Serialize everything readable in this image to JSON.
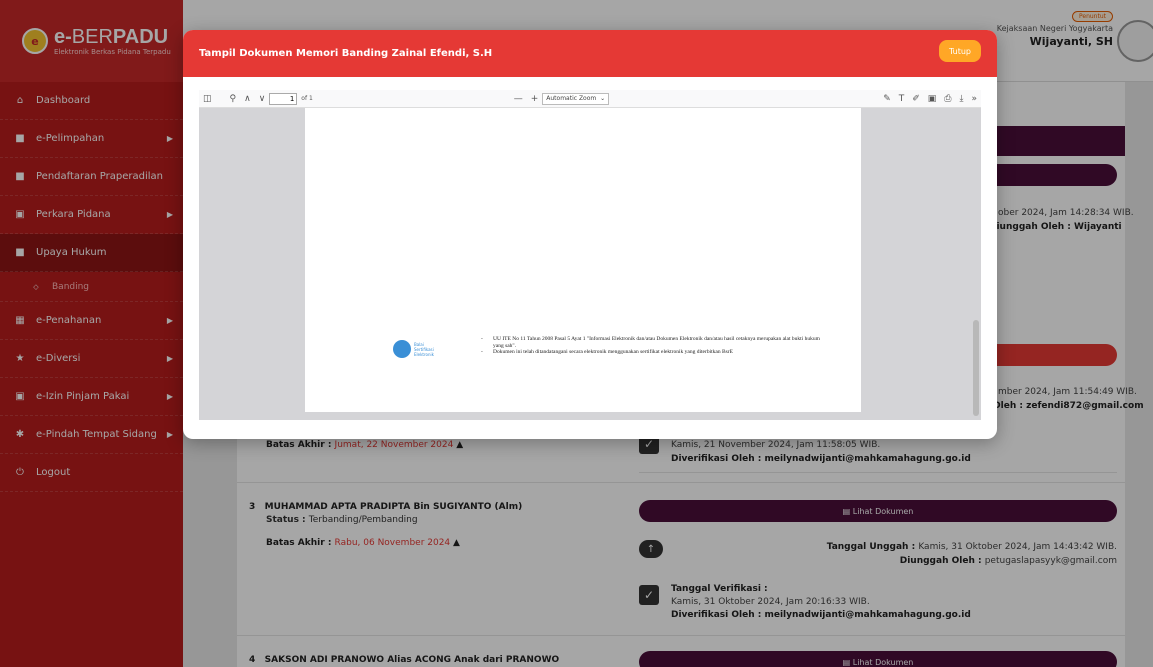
{
  "header": {
    "logo_badge": "e",
    "logo_title_prefix": "e-",
    "logo_title_thin": "BER",
    "logo_title_bold": "PADU",
    "logo_sub": "Elektronik Berkas Pidana Terpadu",
    "role": "Penuntut",
    "org": "Kejaksaan Negeri Yogyakarta",
    "username": "Wijayanti, SH"
  },
  "sidebar": {
    "items": [
      {
        "label": "Dashboard",
        "icon": "home-icon"
      },
      {
        "label": "e-Pelimpahan",
        "icon": "folder-icon"
      },
      {
        "label": "Pendaftaran Praperadilan",
        "icon": "folder-icon"
      },
      {
        "label": "Perkara Pidana",
        "icon": "checkbox-icon"
      },
      {
        "label": "Upaya Hukum",
        "icon": "folder-icon"
      },
      {
        "label": "Banding",
        "icon": "circle-icon"
      },
      {
        "label": "e-Penahanan",
        "icon": "grid-icon"
      },
      {
        "label": "e-Diversi",
        "icon": "star-icon"
      },
      {
        "label": "e-Izin Pinjam Pakai",
        "icon": "checkbox-icon"
      },
      {
        "label": "e-Pindah Tempat Sidang",
        "icon": "gear-icon"
      },
      {
        "label": "Logout",
        "icon": "power-icon"
      }
    ]
  },
  "modal": {
    "title": "Tampil Dokumen Memori Banding Zainal Efendi, S.H",
    "close_label": "Tutup",
    "pdf": {
      "page_current": "1",
      "page_total": "of 1",
      "zoom": "Automatic Zoom",
      "logo_text_1": "Balai",
      "logo_text_2": "Sertifikasi",
      "logo_text_3": "Elektronik",
      "note_1": "UU ITE No 11 Tahun 2008 Pasal 5 Ayat 1 \"Informasi Elektronik dan/atau Dokumen Elektronik dan/atau hasil cetaknya merupakan alat bukti hukum yang sah\".",
      "note_2": "Dokumen ini telah ditandatangani secara elektronik menggunakan sertifikat elektronik yang diterbitkan BsrE"
    }
  },
  "main": {
    "upload_1_tail": "ober 2024, Jam 14:28:34 WIB.",
    "upload_1_by": "Diunggah Oleh : Wijayanti",
    "upload_2_tail": "mber 2024, Jam 11:54:49 WIB.",
    "upload_2_by": "Oleh : zefendi872@gmail.com",
    "row2_deadline_label": "Batas Akhir : ",
    "row2_deadline": "Jumat, 22 November 2024",
    "row2_verif_date": "Kamis, 21 November 2024, Jam 11:58:05 WIB.",
    "row2_verif_by_label": "Diverifikasi Oleh : ",
    "row2_verif_by": "meilynadwijanti@mahkamahagung.go.id",
    "row3_num": "3",
    "row3_name": "MUHAMMAD APTA PRADIPTA Bin SUGIYANTO (Alm)",
    "row3_status_label": "Status : ",
    "row3_status": "Terbanding/Pembanding",
    "row3_deadline_label": "Batas Akhir : ",
    "row3_deadline": "Rabu, 06 November 2024",
    "row3_view": "Lihat Dokumen",
    "row3_upload_label": "Tanggal Unggah : ",
    "row3_upload": "Kamis, 31 Oktober 2024, Jam 14:43:42 WIB.",
    "row3_by_label": "Diunggah Oleh : ",
    "row3_by": "petugaslapasyyk@gmail.com",
    "row3_verif_label": "Tanggal Verifikasi :",
    "row3_verif_date": "Kamis, 31 Oktober 2024, Jam 20:16:33 WIB.",
    "row3_verif_by_label": "Diverifikasi Oleh : ",
    "row3_verif_by": "meilynadwijanti@mahkamahagung.go.id",
    "row4_num": "4",
    "row4_name": "SAKSON ADI PRANOWO Alias ACONG Anak dari PRANOWO",
    "row4_view": "Lihat Dokumen"
  }
}
